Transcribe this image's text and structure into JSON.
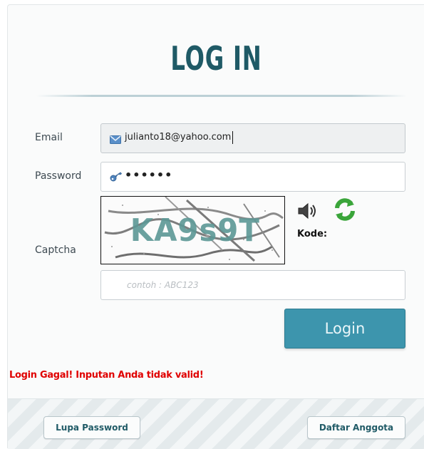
{
  "page": {
    "title": "LOG IN"
  },
  "form": {
    "email_label": "Email",
    "email_value": "julianto18@yahoo.com",
    "password_label": "Password",
    "password_masked": "••••••",
    "captcha_label": "Captcha",
    "captcha_image_text": "KA9s9T",
    "kode_label": "Kode:",
    "code_placeholder": "contoh : ABC123",
    "login_button": "Login"
  },
  "error_message": "Login Gagal! Inputan Anda tidak valid!",
  "footer": {
    "forgot_password": "Lupa Password",
    "register": "Daftar Anggota"
  },
  "colors": {
    "title": "#1f5a66",
    "login_button": "#3d95ad",
    "error": "#e00000",
    "refresh_icon": "#3aa53a"
  },
  "icons": {
    "email": "envelope-icon",
    "password": "key-icon",
    "audio": "speaker-icon",
    "refresh": "refresh-icon"
  }
}
